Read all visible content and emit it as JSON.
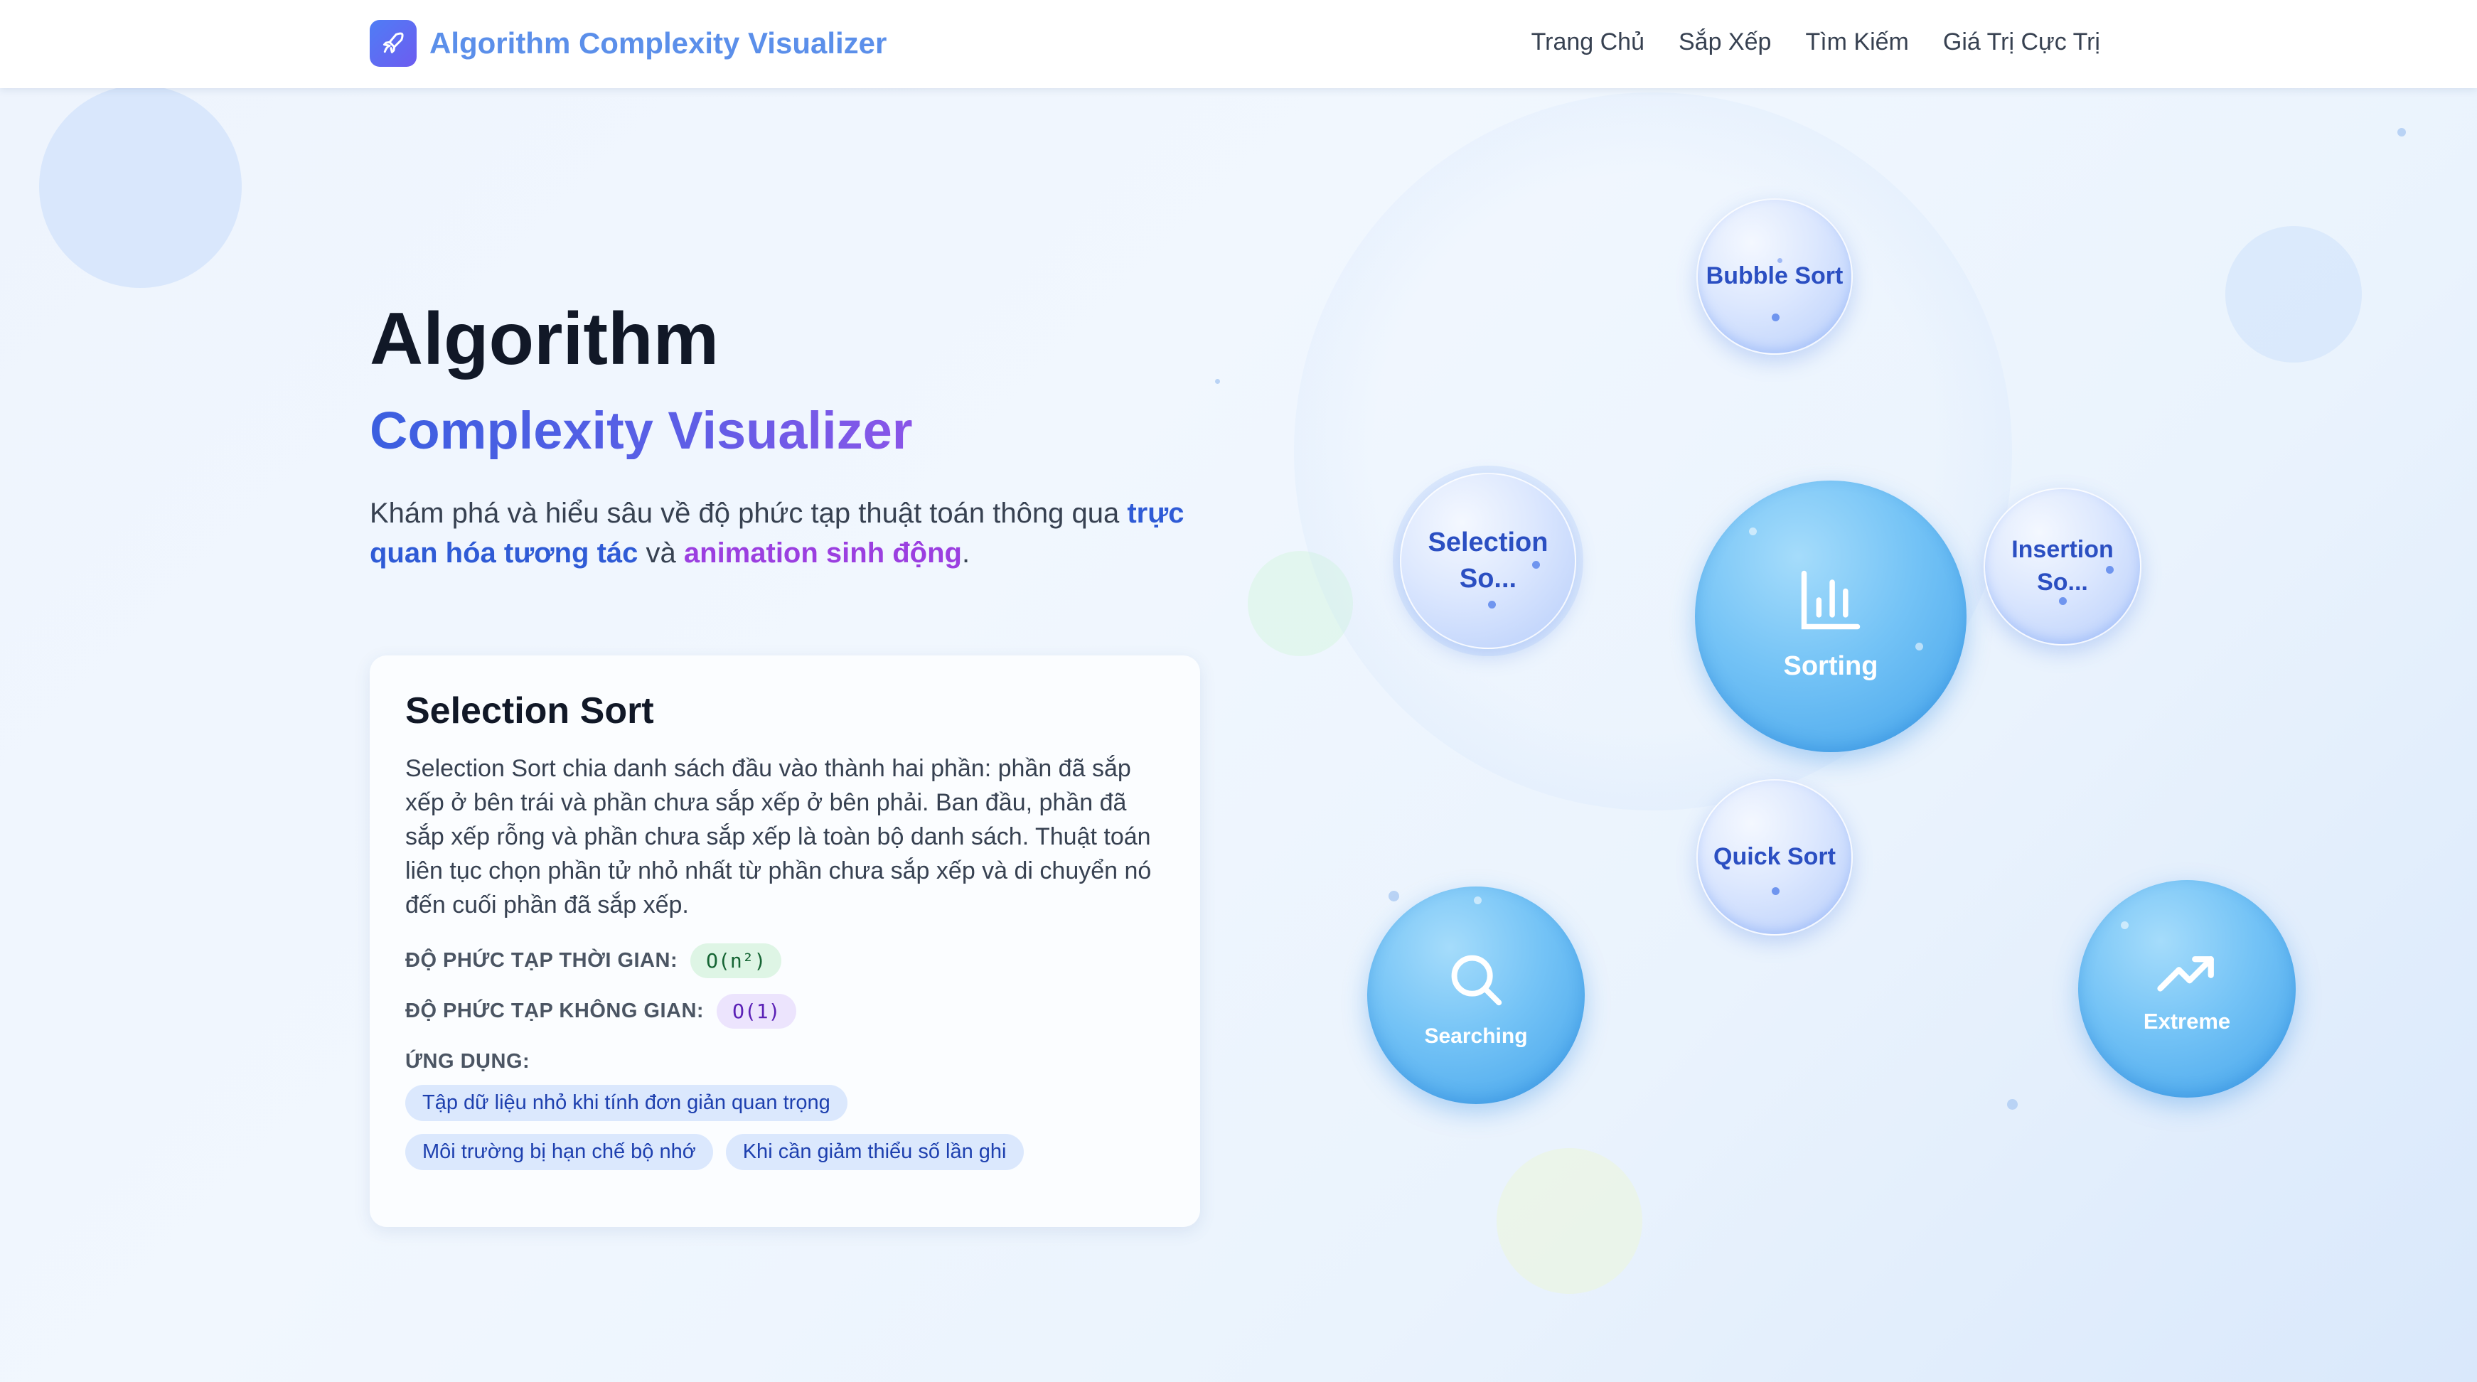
{
  "navbar": {
    "brand": "Algorithm Complexity Visualizer",
    "links": [
      "Trang Chủ",
      "Sắp Xếp",
      "Tìm Kiếm",
      "Giá Trị Cực Trị"
    ]
  },
  "hero": {
    "title": "Algorithm",
    "subtitle": "Complexity Visualizer",
    "desc_before": "Khám phá và hiểu sâu về độ phức tạp thuật toán thông qua ",
    "desc_highlight_1": "trực quan hóa tương tác",
    "desc_middle": " và ",
    "desc_highlight_2": "animation sinh động",
    "desc_after": "."
  },
  "card": {
    "title": "Selection Sort",
    "description": "Selection Sort chia danh sách đầu vào thành hai phần: phần đã sắp xếp ở bên trái và phần chưa sắp xếp ở bên phải. Ban đầu, phần đã sắp xếp rỗng và phần chưa sắp xếp là toàn bộ danh sách. Thuật toán liên tục chọn phần tử nhỏ nhất từ phần chưa sắp xếp và di chuyển nó đến cuối phần đã sắp xếp.",
    "time_label": "ĐỘ PHỨC TẠP THỜI GIAN:",
    "time_value": "O(n²)",
    "space_label": "ĐỘ PHỨC TẠP KHÔNG GIAN:",
    "space_value": "O(1)",
    "apps_label": "ỨNG DỤNG:",
    "apps": [
      "Tập dữ liệu nhỏ khi tính đơn giản quan trọng",
      "Môi trường bị hạn chế bộ nhớ",
      "Khi cần giảm thiểu số lần ghi"
    ]
  },
  "bubbles": {
    "bubble_sort": "Bubble Sort",
    "selection_line1": "Selection",
    "selection_line2": "So...",
    "sorting": "Sorting",
    "insertion_line1": "Insertion",
    "insertion_line2": "So...",
    "quick_sort": "Quick Sort",
    "searching": "Searching",
    "extreme": "Extreme"
  },
  "icons": {
    "brand": "rocket-icon",
    "sorting": "bar-chart-icon",
    "searching": "search-icon",
    "extreme": "trending-up-icon"
  },
  "colors": {
    "brand_text": "#5b8fea",
    "highlight_blue": "#2f5bd6",
    "highlight_purple": "#9b3fe0",
    "bubble_primary": "#42a2ea",
    "tag_bg": "#dbe8fd"
  }
}
